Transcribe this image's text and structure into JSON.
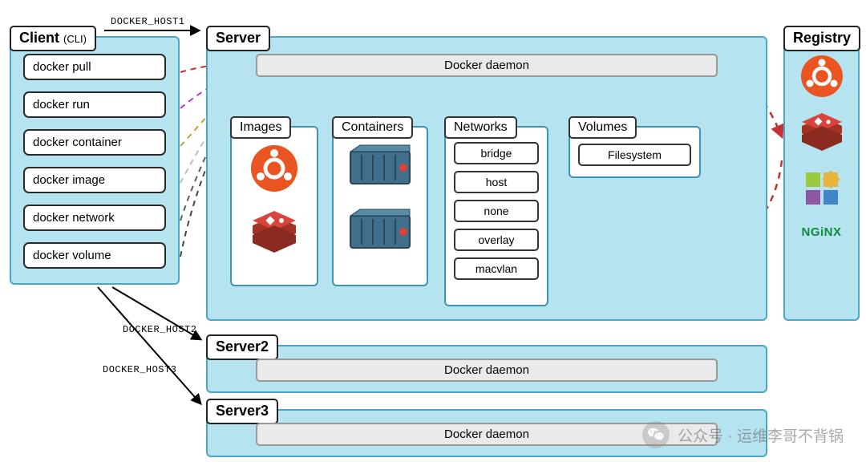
{
  "client": {
    "title": "Client",
    "subtitle": "(CLI)",
    "commands": [
      "docker pull",
      "docker run",
      "docker container",
      "docker image",
      "docker network",
      "docker volume"
    ]
  },
  "server": {
    "title": "Server",
    "daemon": "Docker daemon",
    "images_title": "Images",
    "containers_title": "Containers",
    "networks_title": "Networks",
    "volumes_title": "Volumes",
    "networks": [
      "bridge",
      "host",
      "none",
      "overlay",
      "macvlan"
    ],
    "volumes": [
      "Filesystem"
    ]
  },
  "server2": {
    "title": "Server2",
    "daemon": "Docker daemon"
  },
  "server3": {
    "title": "Server3",
    "daemon": "Docker daemon"
  },
  "registry": {
    "title": "Registry",
    "nginx": "NGiNX"
  },
  "host_labels": {
    "h1": "DOCKER_HOST1",
    "h2": "DOCKER_HOST2",
    "h3": "DOCKER_HOST3"
  },
  "watermark": "公众号 · 运维李哥不背锅"
}
